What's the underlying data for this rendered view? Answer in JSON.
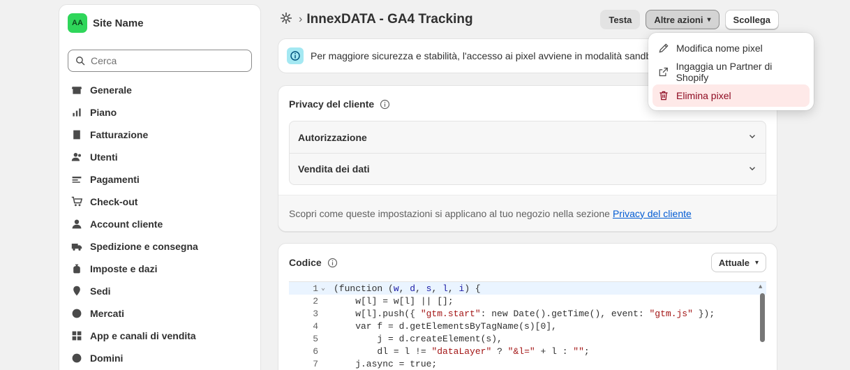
{
  "sidebar": {
    "store": {
      "initials": "AA",
      "name": "Site Name"
    },
    "search_placeholder": "Cerca",
    "items": [
      {
        "label": "Generale",
        "icon": "store-icon"
      },
      {
        "label": "Piano",
        "icon": "chart-bars-icon"
      },
      {
        "label": "Fatturazione",
        "icon": "dollar-receipt-icon"
      },
      {
        "label": "Utenti",
        "icon": "users-icon"
      },
      {
        "label": "Pagamenti",
        "icon": "payments-icon"
      },
      {
        "label": "Check-out",
        "icon": "cart-icon"
      },
      {
        "label": "Account cliente",
        "icon": "person-icon"
      },
      {
        "label": "Spedizione e consegna",
        "icon": "truck-icon"
      },
      {
        "label": "Imposte e dazi",
        "icon": "tax-bag-icon"
      },
      {
        "label": "Sedi",
        "icon": "location-pin-icon"
      },
      {
        "label": "Mercati",
        "icon": "globe-icon"
      },
      {
        "label": "App e canali di vendita",
        "icon": "apps-icon"
      },
      {
        "label": "Domini",
        "icon": "globe-icon"
      }
    ]
  },
  "header": {
    "title": "InnexDATA - GA4 Tracking",
    "buttons": {
      "test": "Testa",
      "more": "Altre azioni",
      "disconnect": "Scollega"
    }
  },
  "banner": {
    "text": "Per maggiore sicurezza e stabilità, l'accesso ai pixel avviene in modalità sandbox."
  },
  "privacy": {
    "title": "Privacy del cliente",
    "rows": [
      "Autorizzazione",
      "Vendita dei dati"
    ],
    "footer_text": "Scopri come queste impostazioni si applicano al tuo negozio nella sezione",
    "footer_link": "Privacy del cliente"
  },
  "code": {
    "title": "Codice",
    "version": "Attuale",
    "line_numbers": [
      "1",
      "2",
      "3",
      "4",
      "5",
      "6",
      "7"
    ]
  },
  "menu": {
    "items": [
      {
        "label": "Modifica nome pixel",
        "icon": "pencil-icon"
      },
      {
        "label": "Ingaggia un Partner di Shopify",
        "icon": "external-link-icon"
      },
      {
        "label": "Elimina pixel",
        "icon": "trash-icon"
      }
    ]
  },
  "colors": {
    "accent_green": "#2fd65a",
    "link": "#005bd3",
    "danger": "#8e0b21",
    "danger_bg": "#fee9e8",
    "info_bg": "#a4e8f2"
  }
}
